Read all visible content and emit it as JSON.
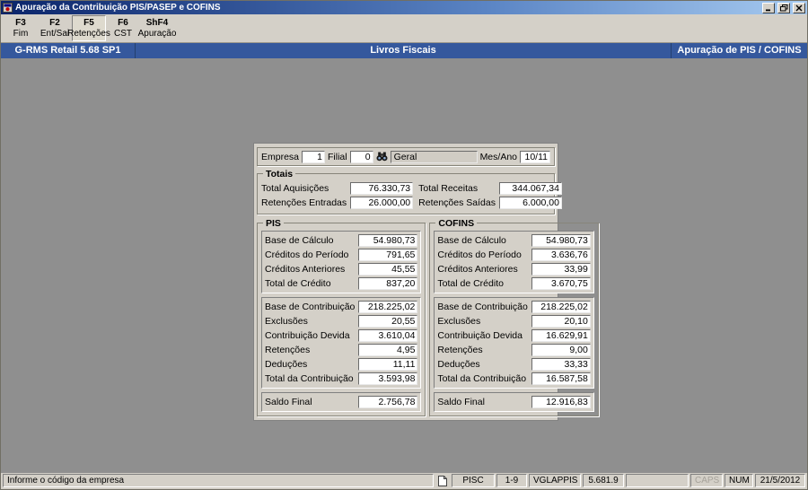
{
  "window": {
    "title": "Apuração da Contribuição PIS/PASEP e COFINS"
  },
  "toolbar": {
    "buttons": [
      {
        "key": "F3",
        "label": "Fim",
        "pressed": false
      },
      {
        "key": "F2",
        "label": "Ent/Sai",
        "pressed": false
      },
      {
        "key": "F5",
        "label": "Retenções",
        "pressed": true
      },
      {
        "key": "F6",
        "label": "CST",
        "pressed": false
      },
      {
        "key": "ShF4",
        "label": "Apuração",
        "pressed": false
      }
    ]
  },
  "header": {
    "left": "G-RMS Retail 5.68 SP1",
    "center": "Livros Fiscais",
    "right": "Apuração de PIS / COFINS"
  },
  "form": {
    "top": {
      "empresa_label": "Empresa",
      "empresa_value": "1",
      "filial_label": "Filial",
      "filial_value": "0",
      "filial_desc": "Geral",
      "mesano_label": "Mes/Ano",
      "mesano_value": "10/11"
    },
    "totais": {
      "title": "Totais",
      "left": [
        {
          "label": "Total Aquisições",
          "value": "76.330,73"
        },
        {
          "label": "Retenções Entradas",
          "value": "26.000,00"
        }
      ],
      "right": [
        {
          "label": "Total Receitas",
          "value": "344.067,34"
        },
        {
          "label": "Retenções Saídas",
          "value": "6.000,00"
        }
      ]
    },
    "pis": {
      "title": "PIS",
      "credits": [
        {
          "label": "Base de Cálculo",
          "value": "54.980,73"
        },
        {
          "label": "Créditos do Período",
          "value": "791,65"
        },
        {
          "label": "Créditos Anteriores",
          "value": "45,55"
        },
        {
          "label": "Total de Crédito",
          "value": "837,20"
        }
      ],
      "contribution": [
        {
          "label": "Base de Contribuição",
          "value": "218.225,02"
        },
        {
          "label": "Exclusões",
          "value": "20,55"
        },
        {
          "label": "Contribuição Devida",
          "value": "3.610,04"
        },
        {
          "label": "Retenções",
          "value": "4,95"
        },
        {
          "label": "Deduções",
          "value": "11,11"
        },
        {
          "label": "Total da Contribuição",
          "value": "3.593,98"
        }
      ],
      "final": [
        {
          "label": "Saldo Final",
          "value": "2.756,78"
        }
      ]
    },
    "cofins": {
      "title": "COFINS",
      "credits": [
        {
          "label": "Base de Cálculo",
          "value": "54.980,73"
        },
        {
          "label": "Créditos do Período",
          "value": "3.636,76"
        },
        {
          "label": "Créditos Anteriores",
          "value": "33,99"
        },
        {
          "label": "Total de Crédito",
          "value": "3.670,75"
        }
      ],
      "contribution": [
        {
          "label": "Base de Contribuição",
          "value": "218.225,02"
        },
        {
          "label": "Exclusões",
          "value": "20,10"
        },
        {
          "label": "Contribuição Devida",
          "value": "16.629,91"
        },
        {
          "label": "Retenções",
          "value": "9,00"
        },
        {
          "label": "Deduções",
          "value": "33,33"
        },
        {
          "label": "Total da Contribuição",
          "value": "16.587,58"
        }
      ],
      "final": [
        {
          "label": "Saldo Final",
          "value": "12.916,83"
        }
      ]
    }
  },
  "statusbar": {
    "message": "Informe o código da empresa",
    "screen": "PISC",
    "range": "1-9",
    "program": "VGLAPPIS",
    "version": "5.681.9",
    "caps": "CAPS",
    "num": "NUM",
    "date": "21/5/2012"
  },
  "icons": {
    "titlebar_left": "app-icon",
    "lookup": "binoculars-icon",
    "status": "document-icon"
  },
  "colors": {
    "titlebar_gradient_start": "#0a246a",
    "titlebar_gradient_end": "#a6caf0",
    "header_blue": "#35589d",
    "panel_gray": "#d4d0c8",
    "client_gray": "#8f8f8f"
  }
}
